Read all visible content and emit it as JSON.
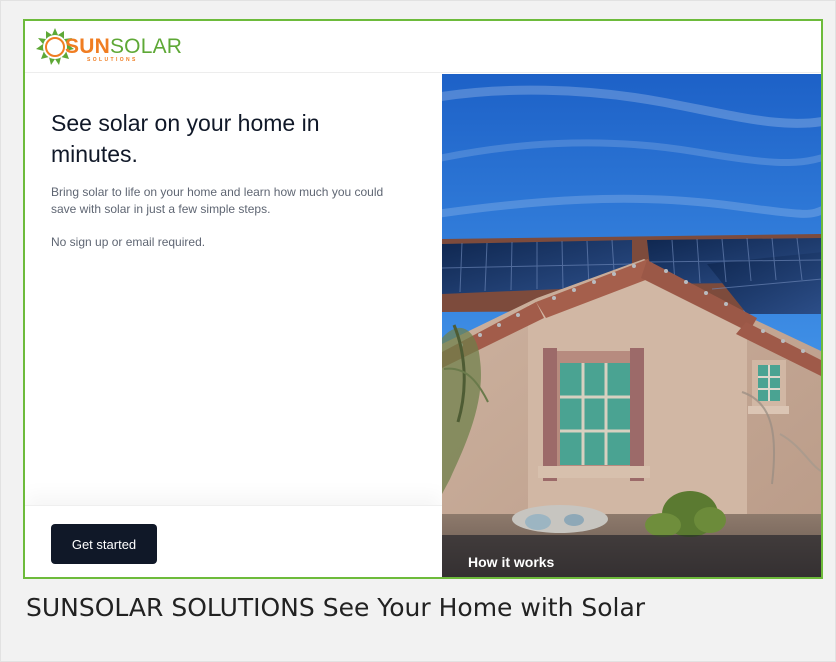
{
  "brand": {
    "sun": "SUN",
    "solar": "SOLAR",
    "sub": "SOLUTIONS",
    "colors": {
      "orange": "#f07d22",
      "green": "#5ea836",
      "frame": "#6dbb3b"
    },
    "icon": "sun-logo-icon"
  },
  "hero": {
    "title": "See solar on your home in minutes.",
    "description": "Bring solar to life on your home and learn how much you could save with solar in just a few simple steps.",
    "note": "No sign up or email required."
  },
  "actions": {
    "get_started": "Get started",
    "how_it_works": "How it works"
  },
  "caption": {
    "text": "SUNSOLAR SOLUTIONS See Your Home with Solar"
  },
  "theme": {
    "button_dark": "#101828",
    "sky_blue": "#2f76d2",
    "overlay_dark": "#141821"
  }
}
